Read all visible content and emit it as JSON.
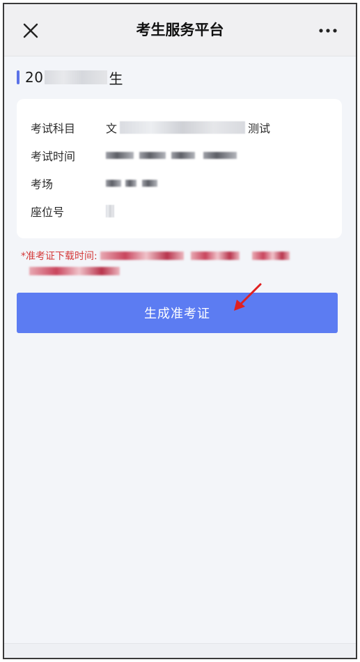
{
  "header": {
    "title": "考生服务平台",
    "close_icon": "close-icon",
    "more_icon": "more-dots-icon"
  },
  "section": {
    "prefix": "20",
    "suffix": "生"
  },
  "card": {
    "rows": [
      {
        "label": "考试科目",
        "value_prefix": "文",
        "value_suffix": "测试"
      },
      {
        "label": "考试时间",
        "value_prefix": "",
        "value_suffix": ""
      },
      {
        "label": "考场",
        "value_prefix": "",
        "value_suffix": ""
      },
      {
        "label": "座位号",
        "value_prefix": "",
        "value_suffix": ""
      }
    ]
  },
  "notice": {
    "label": "*准考证下载时间:"
  },
  "button": {
    "label": "生成准考证"
  },
  "colors": {
    "accent": "#5c7cf2",
    "notice": "#d43a3a",
    "annotation_arrow": "#e02020"
  }
}
